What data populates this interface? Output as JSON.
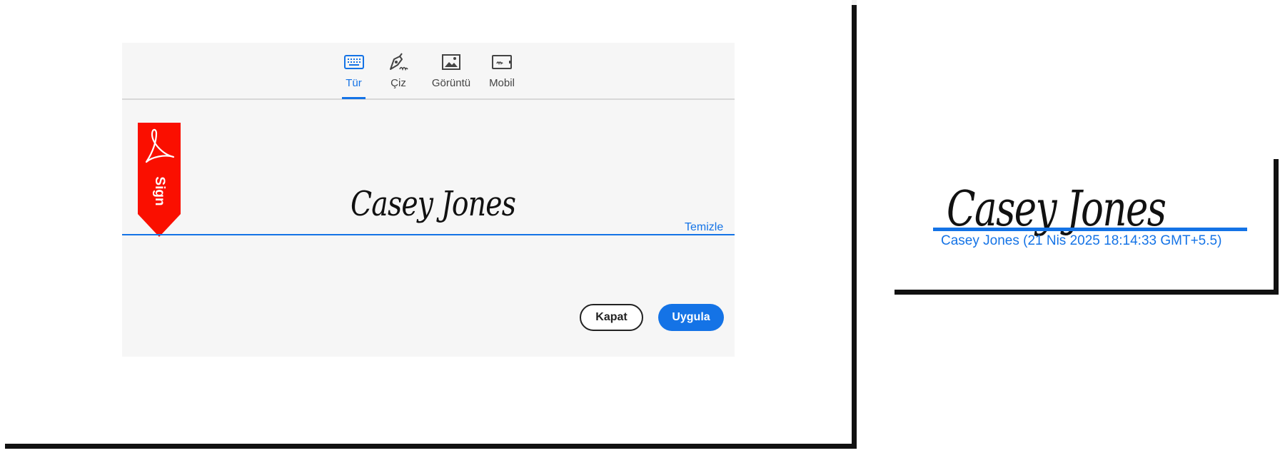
{
  "dialog": {
    "tabs": [
      {
        "label": "Tür",
        "icon": "keyboard-icon",
        "active": true
      },
      {
        "label": "Çiz",
        "icon": "pen-draw-icon",
        "active": false
      },
      {
        "label": "Görüntü",
        "icon": "image-icon",
        "active": false
      },
      {
        "label": "Mobil",
        "icon": "mobile-device-icon",
        "active": false
      }
    ],
    "ribbon_label": "Sign",
    "signature_text": "Casey Jones",
    "clear_label": "Temizle",
    "close_label": "Kapat",
    "apply_label": "Uygula"
  },
  "preview": {
    "signature_text": "Casey Jones",
    "caption": "Casey Jones (21 Nis 2025 18:14:33 GMT+5.5)"
  },
  "colors": {
    "accent": "#1473e6",
    "ribbon": "#fa0f00"
  }
}
